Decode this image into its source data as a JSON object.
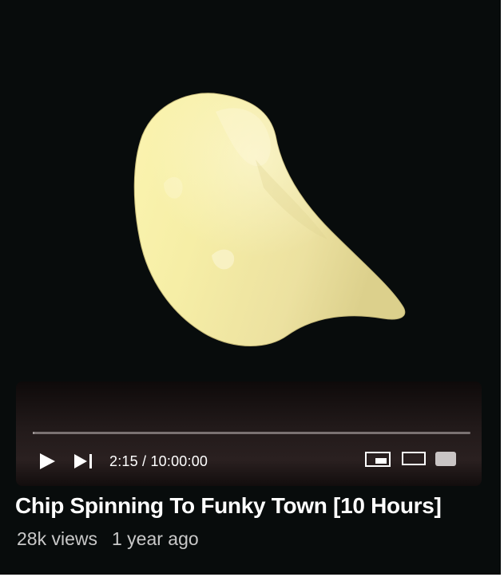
{
  "player": {
    "current_time": "2:15",
    "duration": "10:00:00",
    "time_display": "2:15 / 10:00:00",
    "progress_fraction": 0.00375,
    "controls": {
      "play_icon": "play-icon",
      "next_icon": "skip-next-icon",
      "miniplayer_icon": "miniplayer-icon",
      "theater_icon": "theater-mode-icon",
      "fullscreen_icon": "fullscreen-icon"
    },
    "colors": {
      "background": "#080c0c",
      "chip": "#f4eba6",
      "progress_track": "#7a7272"
    }
  },
  "video": {
    "title": "Chip Spinning To Funky Town [10 Hours]",
    "views": "28k views",
    "age": "1 year ago"
  }
}
